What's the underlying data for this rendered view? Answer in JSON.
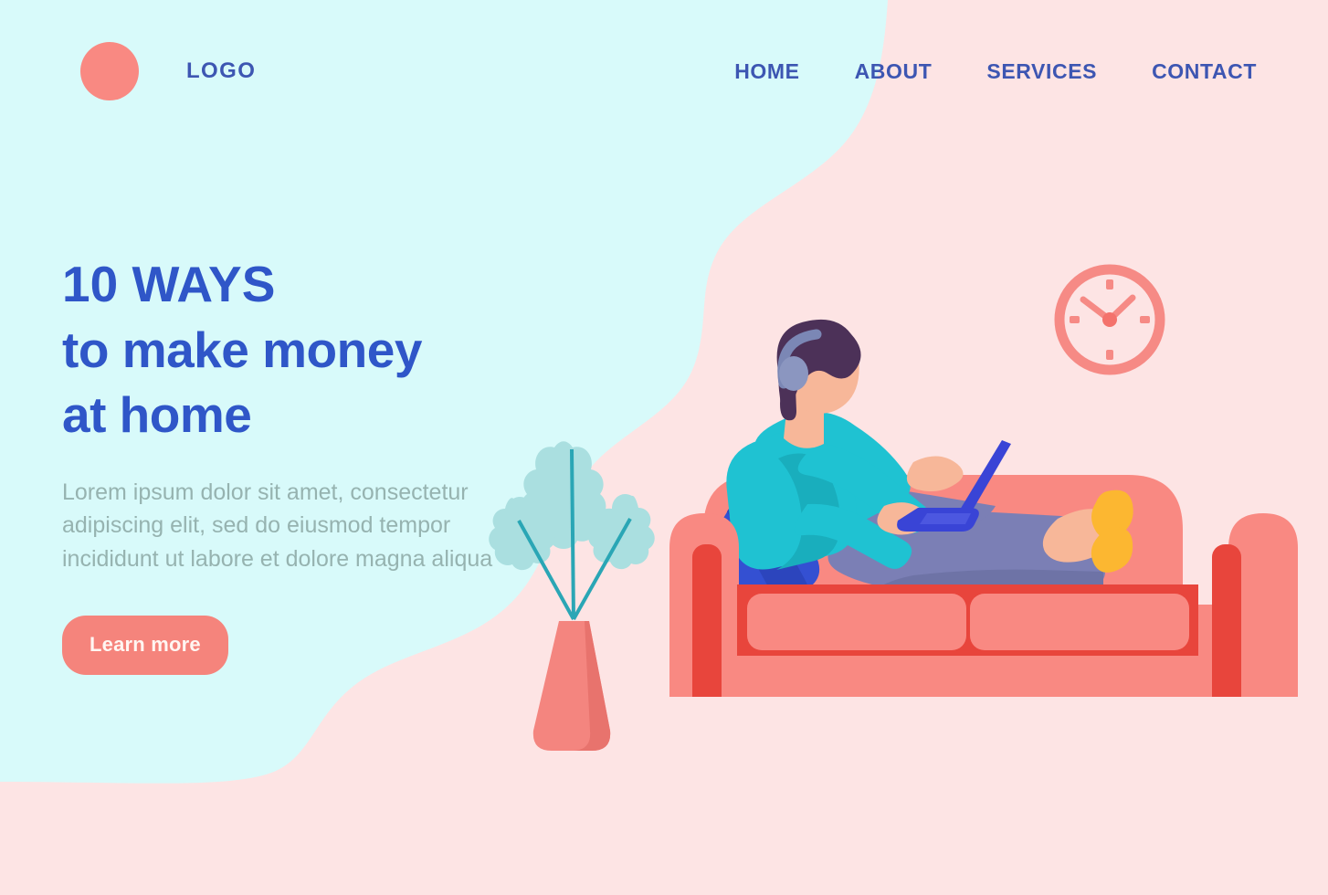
{
  "header": {
    "logo": {
      "icon": "logo-circle-icon",
      "text": "LOGO"
    },
    "nav": [
      {
        "label": "HOME"
      },
      {
        "label": "ABOUT"
      },
      {
        "label": "SERVICES"
      },
      {
        "label": "CONTACT"
      }
    ]
  },
  "hero": {
    "headline_line1": "10 WAYS",
    "headline_line2": "to make money",
    "headline_line3": "at home",
    "subcopy": "Lorem ipsum dolor sit amet, consectetur adipiscing elit, sed do eiusmod tempor incididunt ut labore et dolore magna aliqua",
    "cta_label": "Learn more"
  },
  "illustration": {
    "scene": "person-lying-on-sofa-with-laptop",
    "elements": [
      "wall-clock-icon",
      "plant-vase-icon",
      "sofa-icon",
      "person-icon",
      "laptop-icon",
      "pillow-icon",
      "headphones-icon"
    ]
  },
  "colors": {
    "bg_cyan": "#d8fafa",
    "bg_pink": "#fde4e4",
    "bg_pink_deep": "#fcd8d8",
    "brand_coral": "#f98982",
    "accent_blue": "#3d56b2",
    "headline_blue": "#2f56c8",
    "body_text": "#96b3b0",
    "button_bg": "#f5847c",
    "button_text": "#fff6f2",
    "sofa_salmon": "#f98982",
    "sofa_red": "#e8453c",
    "sweater_teal": "#1fc2d2",
    "pants_purple": "#7b7fb5",
    "pillow_blue": "#3450d2",
    "laptop_blue": "#3944d6",
    "skin": "#f7b799",
    "hair_purple": "#4c3158",
    "headphone_gray": "#7b87b5",
    "sock_yellow": "#fcb731",
    "leaf_teal": "#aadfe0",
    "stem_teal": "#2aa6b5"
  }
}
